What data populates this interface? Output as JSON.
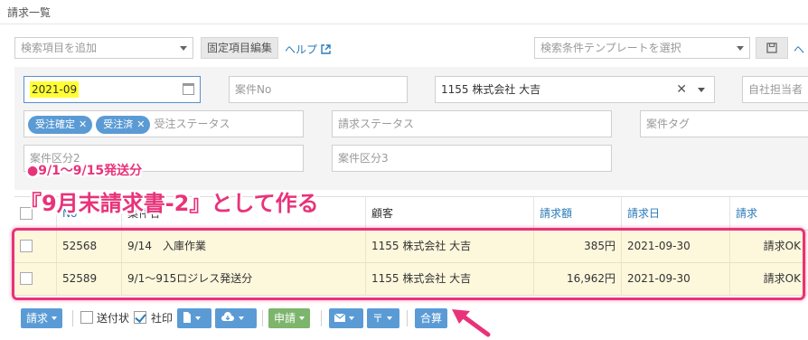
{
  "page": {
    "title": "請求一覧"
  },
  "search_bar": {
    "add_item_placeholder": "検索項目を追加",
    "fixed_edit_label": "固定項目編集",
    "help_label": "ヘルプ",
    "template_placeholder": "検索条件テンプレートを選択",
    "help2_label": "ヘ"
  },
  "filters": {
    "month_value": "2021-09",
    "case_no_placeholder": "案件No",
    "customer_value": "1155 株式会社 大吉",
    "owner_placeholder": "自社担当者",
    "order_status_tags": [
      "受注確定",
      "受注済"
    ],
    "order_status_placeholder": "受注ステータス",
    "invoice_status_placeholder": "請求ステータス",
    "case_tag_placeholder": "案件タグ",
    "case_class2_placeholder": "案件区分2",
    "case_class3_placeholder": "案件区分3"
  },
  "annotation": {
    "note_small": "●9/1～9/15発送分",
    "note_large": "『9月末請求書-2』として作る"
  },
  "table": {
    "columns": [
      "No",
      "案件名",
      "顧客",
      "請求額",
      "請求日",
      "請求"
    ],
    "rows": [
      {
        "no": "52568",
        "case": "9/14　入庫作業",
        "customer": "1155 株式会社 大吉",
        "amount": "385円",
        "date": "2021-09-30",
        "status": "請求OK"
      },
      {
        "no": "52589",
        "case": "9/1～915ロジレス発送分",
        "customer": "1155 株式会社 大吉",
        "amount": "16,962円",
        "date": "2021-09-30",
        "status": "請求OK"
      }
    ]
  },
  "toolbar": {
    "invoice_label": "請求",
    "shipping_slip_label": "送付状",
    "company_seal_label": "社印",
    "company_seal_checked": true,
    "apply_label": "申請",
    "merge_label": "合算"
  },
  "colors": {
    "accent_blue": "#5b9bd5",
    "highlight_pink": "#e8337a",
    "row_bg": "#fdf7dc",
    "green": "#7cb56b"
  }
}
